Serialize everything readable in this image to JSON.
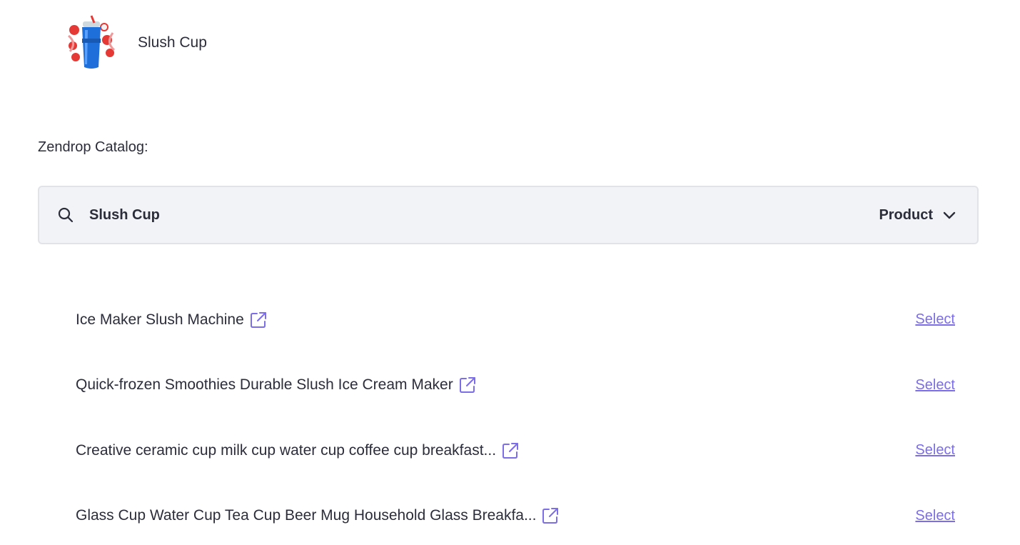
{
  "product": {
    "name": "Slush Cup",
    "thumbnail_icon": "slush-cup-product-image"
  },
  "catalog": {
    "label": "Zendrop Catalog:"
  },
  "search": {
    "value": "Slush Cup",
    "icon": "search-icon",
    "type_selected": "Product"
  },
  "results": [
    {
      "title": "Ice Maker Slush Machine",
      "action": "Select"
    },
    {
      "title": "Quick-frozen Smoothies Durable Slush Ice Cream Maker",
      "action": "Select"
    },
    {
      "title": "Creative ceramic cup milk cup water cup coffee cup breakfast...",
      "action": "Select"
    },
    {
      "title": "Glass Cup Water Cup Tea Cup Beer Mug Household Glass Breakfa...",
      "action": "Select"
    }
  ],
  "colors": {
    "accent": "#7b6ee6",
    "text": "#2b2d3a",
    "search_bg": "#f2f3f6",
    "search_border": "#e1e3e8"
  }
}
